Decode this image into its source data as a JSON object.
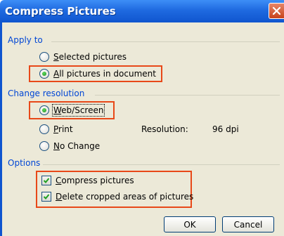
{
  "dialog": {
    "title": "Compress Pictures"
  },
  "apply_to": {
    "label": "Apply to",
    "selected_first": "S",
    "selected_rest": "elected pictures",
    "all_first": "A",
    "all_rest": "ll pictures in document",
    "selected_option": "All pictures in document"
  },
  "change_resolution": {
    "label": "Change resolution",
    "web_first": "W",
    "web_rest": "eb/Screen",
    "print_first": "P",
    "print_rest": "rint",
    "nochange_first": "N",
    "nochange_rest": "o Change",
    "selected_option": "Web/Screen",
    "resolution_label": "Resolution:",
    "resolution_value": "96 dpi"
  },
  "options": {
    "label": "Options",
    "compress_first": "C",
    "compress_rest": "ompress pictures",
    "compress_checked": true,
    "delete_first": "D",
    "delete_rest": "elete cropped areas of pictures",
    "delete_checked": true
  },
  "buttons": {
    "ok": "OK",
    "cancel": "Cancel"
  },
  "colors": {
    "title_bar": "#1f6ae0",
    "group_label": "#0046d5",
    "highlight": "#e84818",
    "dialog_bg": "#ece9d8"
  }
}
